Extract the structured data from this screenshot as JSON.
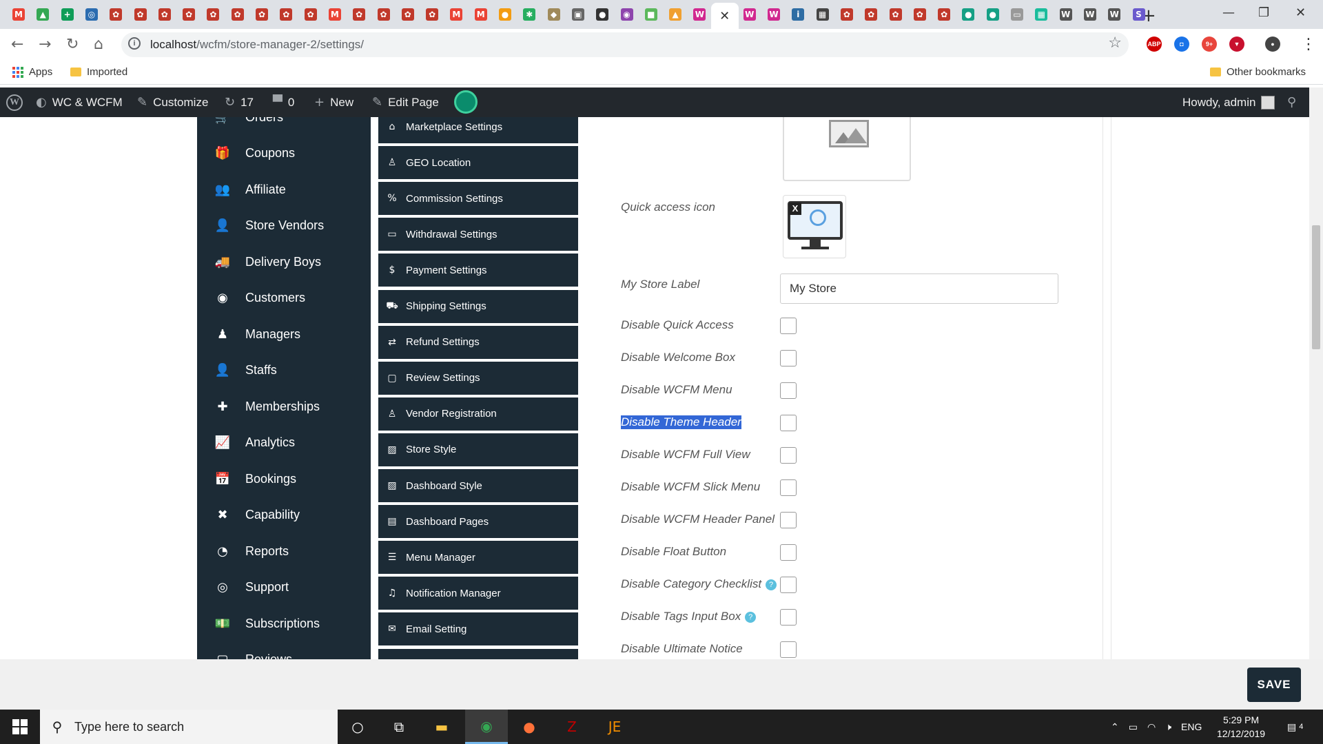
{
  "browser": {
    "tabs": [
      {
        "icon": "gmail-icon",
        "glyph": "M",
        "color": "#ea4335"
      },
      {
        "icon": "drive-icon",
        "glyph": "▲",
        "color": "#34a853"
      },
      {
        "icon": "sheets-icon",
        "glyph": "+",
        "color": "#0f9d58"
      },
      {
        "icon": "ns-icon",
        "glyph": "◎",
        "color": "#2b6cb0"
      },
      {
        "icon": "site-icon",
        "glyph": "✿",
        "color": "#c0392b"
      },
      {
        "icon": "site-icon",
        "glyph": "✿",
        "color": "#c0392b"
      },
      {
        "icon": "site-icon",
        "glyph": "✿",
        "color": "#c0392b"
      },
      {
        "icon": "site-icon",
        "glyph": "✿",
        "color": "#c0392b"
      },
      {
        "icon": "site-icon",
        "glyph": "✿",
        "color": "#c0392b"
      },
      {
        "icon": "site-icon",
        "glyph": "✿",
        "color": "#c0392b"
      },
      {
        "icon": "site-icon",
        "glyph": "✿",
        "color": "#c0392b"
      },
      {
        "icon": "site-icon",
        "glyph": "✿",
        "color": "#c0392b"
      },
      {
        "icon": "site-icon",
        "glyph": "✿",
        "color": "#c0392b"
      },
      {
        "icon": "gmail-icon",
        "glyph": "M",
        "color": "#ea4335"
      },
      {
        "icon": "site-icon",
        "glyph": "✿",
        "color": "#c0392b"
      },
      {
        "icon": "site-icon",
        "glyph": "✿",
        "color": "#c0392b"
      },
      {
        "icon": "site-icon",
        "glyph": "✿",
        "color": "#c0392b"
      },
      {
        "icon": "site-icon",
        "glyph": "✿",
        "color": "#c0392b"
      },
      {
        "icon": "gmail-icon",
        "glyph": "M",
        "color": "#ea4335"
      },
      {
        "icon": "gmail-icon",
        "glyph": "M",
        "color": "#ea4335"
      },
      {
        "icon": "orange-icon",
        "glyph": "●",
        "color": "#f39c12"
      },
      {
        "icon": "leaf-icon",
        "glyph": "✱",
        "color": "#27ae60"
      },
      {
        "icon": "tag-icon",
        "glyph": "◆",
        "color": "#a08a5a"
      },
      {
        "icon": "bag-icon",
        "glyph": "▣",
        "color": "#666666"
      },
      {
        "icon": "mask-icon",
        "glyph": "●",
        "color": "#333333"
      },
      {
        "icon": "globe-icon",
        "glyph": "◉",
        "color": "#8e44ad"
      },
      {
        "icon": "map-icon",
        "glyph": "■",
        "color": "#5cb85c"
      },
      {
        "icon": "pma-icon",
        "glyph": "▲",
        "color": "#f0a030"
      },
      {
        "icon": "woo-icon",
        "glyph": "W",
        "color": "#d1288f"
      },
      {
        "icon": "close-icon",
        "glyph": "✕",
        "color": "#ffffff",
        "active": true
      },
      {
        "icon": "woo-icon",
        "glyph": "W",
        "color": "#d1288f"
      },
      {
        "icon": "woo-icon",
        "glyph": "W",
        "color": "#d1288f"
      },
      {
        "icon": "ibb-icon",
        "glyph": "i",
        "color": "#2e6da4"
      },
      {
        "icon": "film-icon",
        "glyph": "▦",
        "color": "#444444"
      },
      {
        "icon": "site-icon",
        "glyph": "✿",
        "color": "#c0392b"
      },
      {
        "icon": "site-icon",
        "glyph": "✿",
        "color": "#c0392b"
      },
      {
        "icon": "site-icon",
        "glyph": "✿",
        "color": "#c0392b"
      },
      {
        "icon": "site-icon",
        "glyph": "✿",
        "color": "#c0392b"
      },
      {
        "icon": "site-icon",
        "glyph": "✿",
        "color": "#c0392b"
      },
      {
        "icon": "teal-globe-icon",
        "glyph": "●",
        "color": "#16a085"
      },
      {
        "icon": "teal-globe-icon",
        "glyph": "●",
        "color": "#16a085"
      },
      {
        "icon": "monitor-icon",
        "glyph": "▭",
        "color": "#999999"
      },
      {
        "icon": "grid-icon",
        "glyph": "▦",
        "color": "#1abc9c"
      },
      {
        "icon": "wordpress-icon",
        "glyph": "W",
        "color": "#555555"
      },
      {
        "icon": "wordpress-icon",
        "glyph": "W",
        "color": "#555555"
      },
      {
        "icon": "wordpress-icon",
        "glyph": "W",
        "color": "#555555"
      },
      {
        "icon": "s-icon",
        "glyph": "S",
        "color": "#6a5acd"
      }
    ],
    "url_host": "localhost",
    "url_path": "/wcfm/store-manager-2/settings/",
    "extensions": [
      {
        "icon": "adblock-icon",
        "glyph": "ABP",
        "color": "#d00000"
      },
      {
        "icon": "camera-icon",
        "glyph": "◘",
        "color": "#1a73e8"
      },
      {
        "icon": "notification-icon",
        "glyph": "9+",
        "color": "#e8453c"
      },
      {
        "icon": "pocket-icon",
        "glyph": "▼",
        "color": "#c8102e"
      },
      {
        "icon": "profile-icon",
        "glyph": "●",
        "color": "#444444"
      }
    ],
    "bookmarks": {
      "apps": "Apps",
      "imported": "Imported",
      "other": "Other bookmarks"
    }
  },
  "wp_admin_bar": {
    "site_name": "WC & WCFM",
    "customize": "Customize",
    "updates_count": "17",
    "comments_count": "0",
    "new": "New",
    "edit_page": "Edit Page",
    "howdy": "Howdy, admin"
  },
  "main_nav": [
    {
      "label": "Orders",
      "icon": "cart-icon",
      "glyph": "🛒"
    },
    {
      "label": "Coupons",
      "icon": "gift-icon",
      "glyph": "🎁"
    },
    {
      "label": "Affiliate",
      "icon": "users-icon",
      "glyph": "👥"
    },
    {
      "label": "Store Vendors",
      "icon": "user-icon",
      "glyph": "👤"
    },
    {
      "label": "Delivery Boys",
      "icon": "truck-icon",
      "glyph": "🚚"
    },
    {
      "label": "Customers",
      "icon": "user-circle-icon",
      "glyph": "◉"
    },
    {
      "label": "Managers",
      "icon": "manager-icon",
      "glyph": "♟"
    },
    {
      "label": "Staffs",
      "icon": "staff-icon",
      "glyph": "👤"
    },
    {
      "label": "Memberships",
      "icon": "user-plus-icon",
      "glyph": "✚"
    },
    {
      "label": "Analytics",
      "icon": "chart-icon",
      "glyph": "📈"
    },
    {
      "label": "Bookings",
      "icon": "calendar-icon",
      "glyph": "📅"
    },
    {
      "label": "Capability",
      "icon": "user-times-icon",
      "glyph": "✖"
    },
    {
      "label": "Reports",
      "icon": "pie-icon",
      "glyph": "◔"
    },
    {
      "label": "Support",
      "icon": "lifering-icon",
      "glyph": "◎"
    },
    {
      "label": "Subscriptions",
      "icon": "money-icon",
      "glyph": "💵"
    },
    {
      "label": "Reviews",
      "icon": "comment-icon",
      "glyph": "▢"
    }
  ],
  "settings_nav": [
    {
      "label": "Marketplace Settings",
      "icon": "home-icon",
      "glyph": "⌂"
    },
    {
      "label": "GEO Location",
      "icon": "street-view-icon",
      "glyph": "♙"
    },
    {
      "label": "Commission Settings",
      "icon": "percent-icon",
      "glyph": "%"
    },
    {
      "label": "Withdrawal Settings",
      "icon": "credit-card-icon",
      "glyph": "▭"
    },
    {
      "label": "Payment Settings",
      "icon": "dollar-icon",
      "glyph": "$"
    },
    {
      "label": "Shipping Settings",
      "icon": "truck-icon",
      "glyph": "⛟"
    },
    {
      "label": "Refund Settings",
      "icon": "retweet-icon",
      "glyph": "⇄"
    },
    {
      "label": "Review Settings",
      "icon": "comment-icon",
      "glyph": "▢"
    },
    {
      "label": "Vendor Registration",
      "icon": "user-icon",
      "glyph": "♙"
    },
    {
      "label": "Store Style",
      "icon": "image-icon",
      "glyph": "▨"
    },
    {
      "label": "Dashboard Style",
      "icon": "image-icon",
      "glyph": "▨"
    },
    {
      "label": "Dashboard Pages",
      "icon": "id-card-icon",
      "glyph": "▤"
    },
    {
      "label": "Menu Manager",
      "icon": "server-icon",
      "glyph": "☰"
    },
    {
      "label": "Notification Manager",
      "icon": "bell-icon",
      "glyph": "♫"
    },
    {
      "label": "Email Setting",
      "icon": "envelope-icon",
      "glyph": "✉"
    },
    {
      "label": "",
      "icon": "more-icon",
      "glyph": ""
    }
  ],
  "settings": {
    "quick_access_label": "Quick access icon",
    "my_store_label": "My Store Label",
    "my_store_value": "My Store",
    "checkbox_options": [
      {
        "label": "Disable Quick Access",
        "help": false,
        "highlighted": false
      },
      {
        "label": "Disable Welcome Box",
        "help": false,
        "highlighted": false
      },
      {
        "label": "Disable WCFM Menu",
        "help": false,
        "highlighted": false
      },
      {
        "label": "Disable Theme Header",
        "help": false,
        "highlighted": true
      },
      {
        "label": "Disable WCFM Full View",
        "help": false,
        "highlighted": false
      },
      {
        "label": "Disable WCFM Slick Menu",
        "help": false,
        "highlighted": false
      },
      {
        "label": "Disable WCFM Header Panel",
        "help": false,
        "highlighted": false
      },
      {
        "label": "Disable Float Button",
        "help": false,
        "highlighted": false
      },
      {
        "label": "Disable Category Checklist",
        "help": true,
        "highlighted": false
      },
      {
        "label": "Disable Tags Input Box",
        "help": true,
        "highlighted": false
      },
      {
        "label": "Disable Ultimate Notice",
        "help": false,
        "highlighted": false
      }
    ],
    "help_glyph": "?",
    "save_label": "SAVE"
  },
  "taskbar": {
    "search_placeholder": "Type here to search",
    "apps": [
      {
        "icon": "cortana-icon",
        "glyph": "○",
        "color": "#ffffff"
      },
      {
        "icon": "task-view-icon",
        "glyph": "⧉",
        "color": "#ffffff"
      },
      {
        "icon": "file-explorer-icon",
        "glyph": "▬",
        "color": "#f6c342"
      },
      {
        "icon": "chrome-icon",
        "glyph": "◉",
        "color": "#34a853",
        "active": true
      },
      {
        "icon": "firefox-icon",
        "glyph": "●",
        "color": "#ff7139"
      },
      {
        "icon": "filezilla-icon",
        "glyph": "Z",
        "color": "#bf0000"
      },
      {
        "icon": "jetbrains-icon",
        "glyph": "JE",
        "color": "#f08c00"
      }
    ],
    "tray_language": "ENG",
    "time": "5:29 PM",
    "date": "12/12/2019",
    "notifications": "4"
  }
}
